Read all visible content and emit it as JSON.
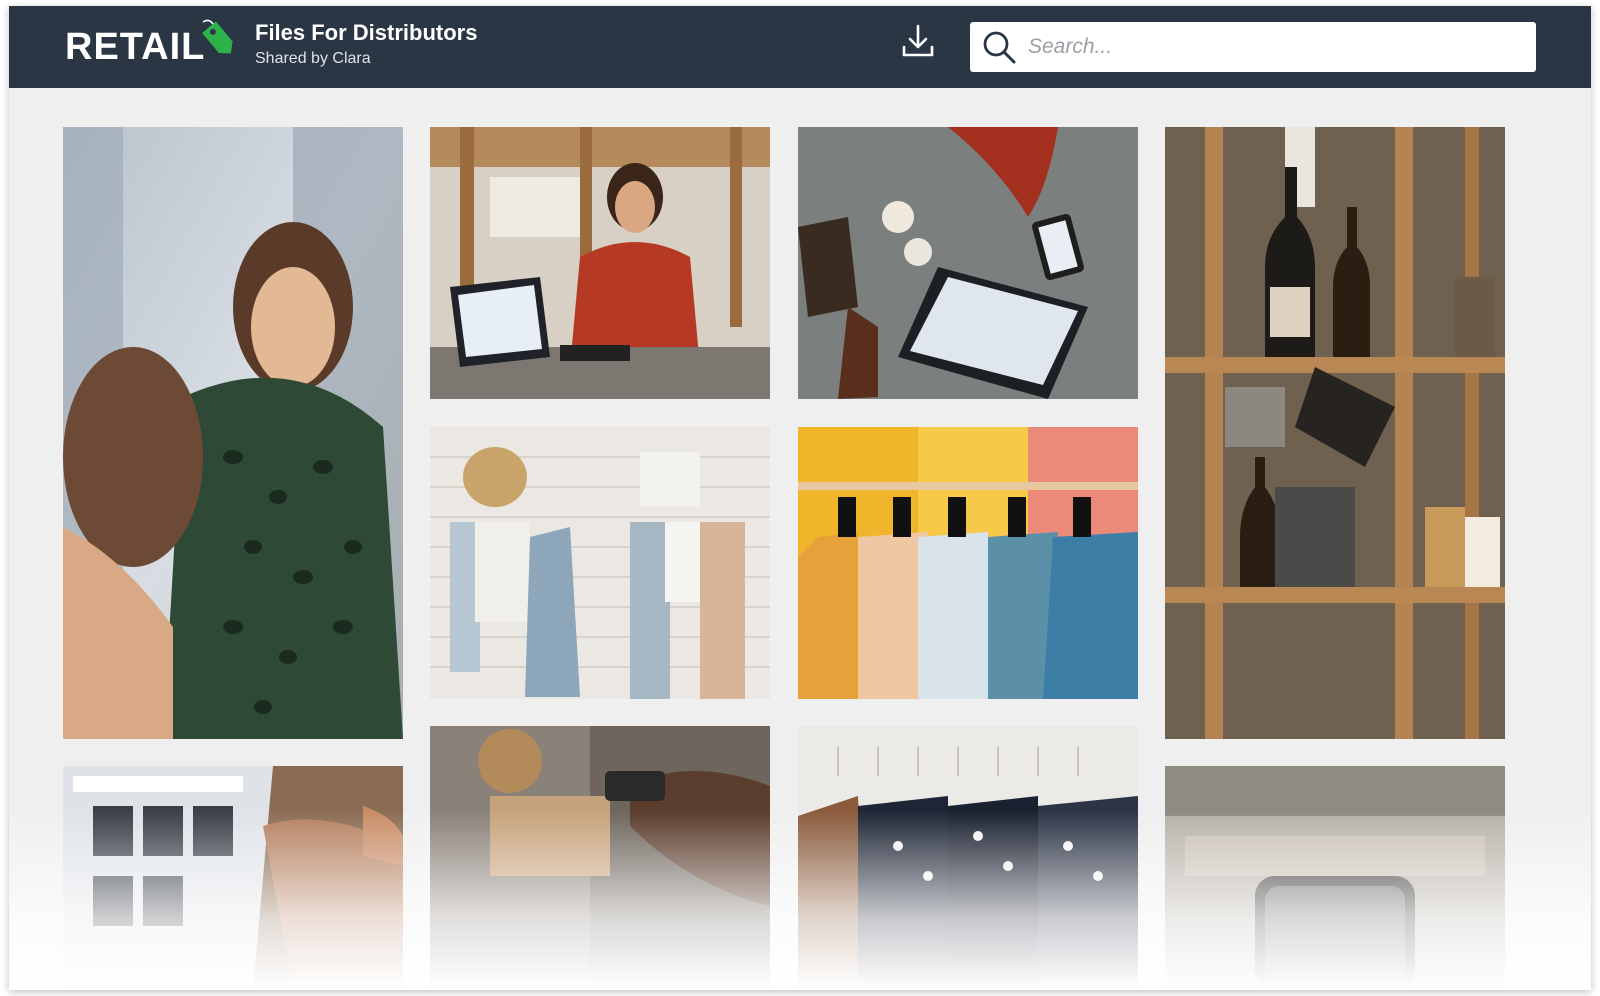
{
  "header": {
    "logo_text": "RETAIL",
    "title": "Files For Distributors",
    "subtitle": "Shared by Clara",
    "download_icon": "download-icon",
    "search": {
      "placeholder": "Search...",
      "value": "",
      "icon": "search-icon"
    }
  },
  "colors": {
    "header_bg": "#2b3644",
    "brand_tag": "#2fb14a",
    "page_bg": "#efefef"
  },
  "gallery": {
    "images": [
      {
        "description": "woman in green patterned top at store counter"
      },
      {
        "description": "woman at point-of-sale terminal in loft store"
      },
      {
        "description": "overhead view of tablet POS, phone and products on counter"
      },
      {
        "description": "wooden shelves with wine bottles and jars"
      },
      {
        "description": "towels and robe hanging on white brick wall"
      },
      {
        "description": "colorful shirts on clothing rack"
      },
      {
        "description": "laptop showing product catalog"
      },
      {
        "description": "hands holding card reader"
      },
      {
        "description": "dark shirts on white hangers"
      },
      {
        "description": "blurred shop interior with phone"
      }
    ]
  }
}
